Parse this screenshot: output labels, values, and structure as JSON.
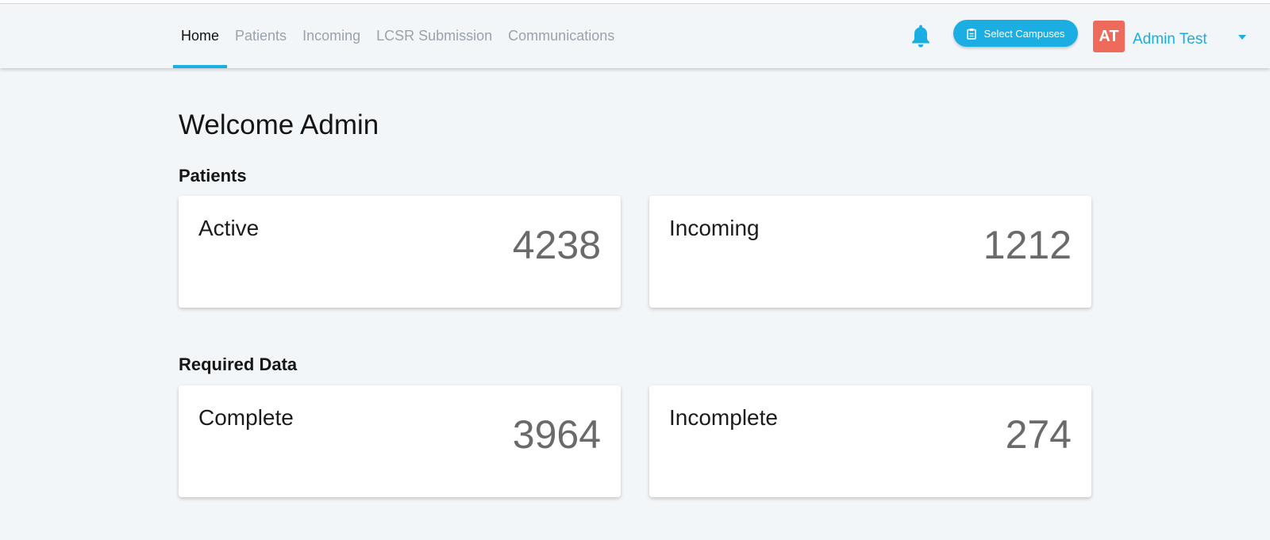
{
  "nav": {
    "tabs": [
      {
        "label": "Home",
        "active": true
      },
      {
        "label": "Patients",
        "active": false
      },
      {
        "label": "Incoming",
        "active": false
      },
      {
        "label": "LCSR Submission",
        "active": false
      },
      {
        "label": "Communications",
        "active": false
      }
    ],
    "notification_icon": "bell-icon",
    "campus_button": {
      "label": "Select Campuses",
      "icon": "clipboard-icon"
    },
    "user": {
      "initials": "AT",
      "name": "Admin Test",
      "menu_icon": "caret-down-icon"
    }
  },
  "main": {
    "welcome": "Welcome Admin",
    "sections": [
      {
        "title": "Patients",
        "cards": [
          {
            "label": "Active",
            "value": "4238"
          },
          {
            "label": "Incoming",
            "value": "1212"
          }
        ]
      },
      {
        "title": "Required Data",
        "cards": [
          {
            "label": "Complete",
            "value": "3964"
          },
          {
            "label": "Incomplete",
            "value": "274"
          }
        ]
      }
    ]
  },
  "colors": {
    "accent": "#1aaee2",
    "avatar": "#ee6a5b",
    "background": "#f3f6f9",
    "card_value": "#6a6a6a"
  }
}
